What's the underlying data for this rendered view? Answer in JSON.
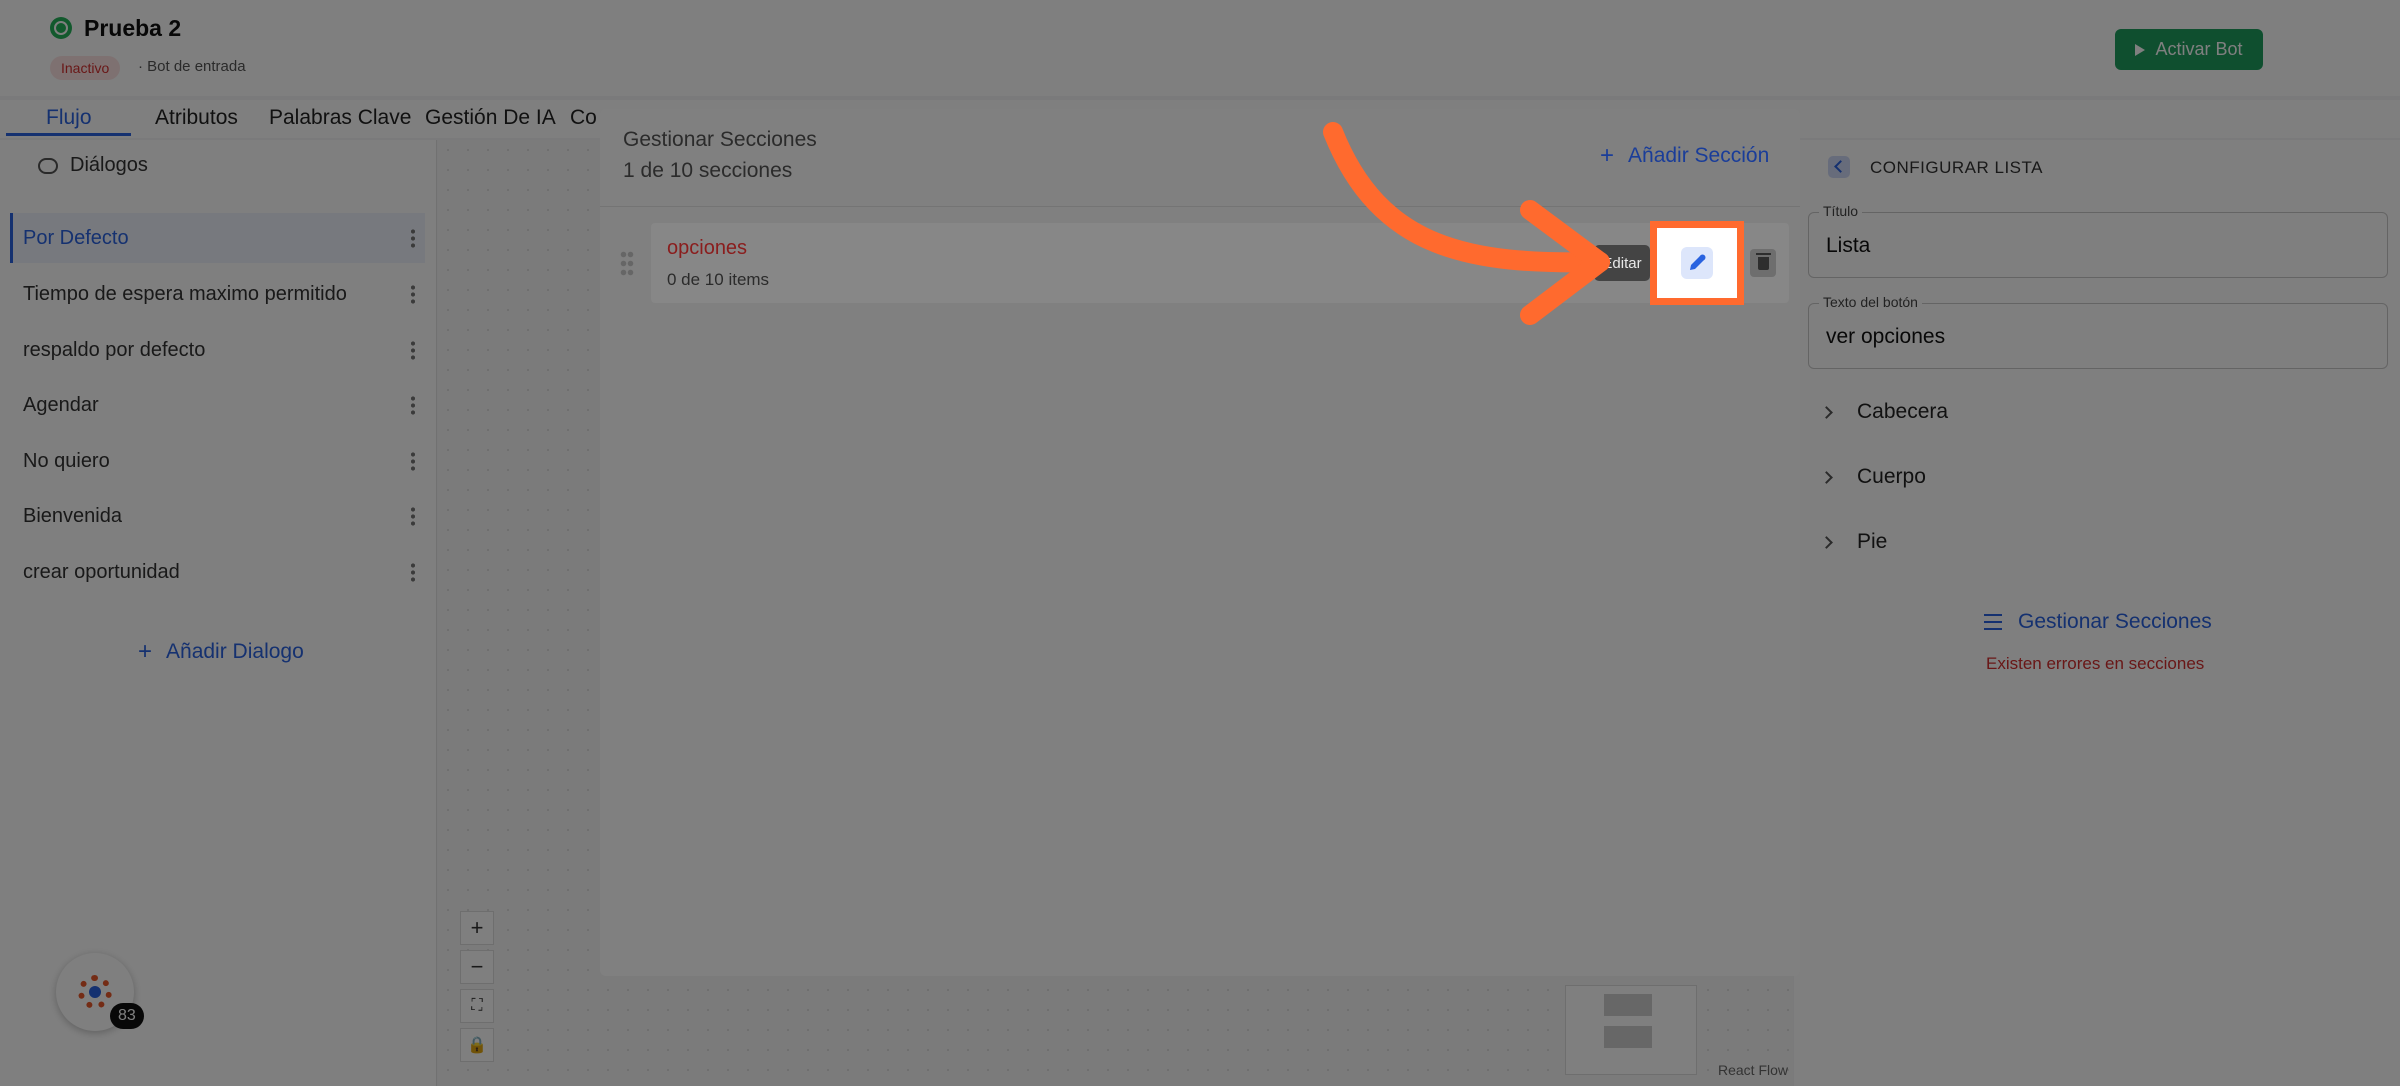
{
  "header": {
    "bot_name": "Prueba 2",
    "status": "Inactivo",
    "bot_type": "· Bot de entrada",
    "activate_label": "Activar Bot"
  },
  "tabs": [
    "Flujo",
    "Atributos",
    "Palabras Clave",
    "Gestión De IA",
    "Co"
  ],
  "sidebar": {
    "title": "Diálogos",
    "items": [
      {
        "label": "Por Defecto",
        "active": true
      },
      {
        "label": "Tiempo de espera maximo permitido"
      },
      {
        "label": "respaldo por defecto"
      },
      {
        "label": "Agendar"
      },
      {
        "label": "No quiero"
      },
      {
        "label": "Bienvenida"
      },
      {
        "label": "crear oportunidad"
      }
    ],
    "add_label": "Añadir Dialogo"
  },
  "canvas": {
    "react_flow_label": "React Flow"
  },
  "right_panel": {
    "title": "CONFIGURAR LISTA",
    "title_field": {
      "label": "Título",
      "value": "Lista"
    },
    "button_field": {
      "label": "Texto del botón",
      "value": "ver opciones"
    },
    "accordions": [
      "Cabecera",
      "Cuerpo",
      "Pie"
    ],
    "manage_label": "Gestionar Secciones",
    "error_text": "Existen errores en secciones"
  },
  "badge": {
    "count": "83"
  },
  "modal": {
    "title": "Gestionar Secciones",
    "count": "1 de 10 secciones",
    "add_label": "Añadir Sección",
    "section": {
      "name": "opciones",
      "items": "0 de 10 items"
    },
    "tooltip": "Editar"
  },
  "colors": {
    "accent": "#2a63e0",
    "highlight": "#ff6a2e",
    "error": "#d32f2f",
    "success": "#1e9e5e"
  }
}
